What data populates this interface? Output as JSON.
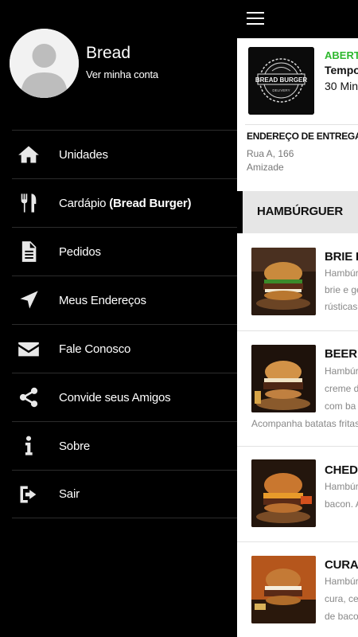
{
  "drawer": {
    "profile": {
      "name": "Bread",
      "link": "Ver minha conta"
    },
    "items": [
      {
        "icon": "home-icon",
        "label": "Unidades",
        "bold": ""
      },
      {
        "icon": "utensils-icon",
        "label": "Cardápio ",
        "bold": "(Bread Burger)"
      },
      {
        "icon": "document-icon",
        "label": "Pedidos",
        "bold": ""
      },
      {
        "icon": "navigation-arrow-icon",
        "label": "Meus Endereços",
        "bold": ""
      },
      {
        "icon": "envelope-icon",
        "label": "Fale Conosco",
        "bold": ""
      },
      {
        "icon": "share-icon",
        "label": "Convide seus Amigos",
        "bold": ""
      },
      {
        "icon": "info-icon",
        "label": "Sobre",
        "bold": ""
      },
      {
        "icon": "sign-out-icon",
        "label": "Sair",
        "bold": ""
      }
    ]
  },
  "store": {
    "logo_text": "BREAD BURGER",
    "logo_sub": "DELIVERY",
    "status": "ABERTO",
    "time_label": "Tempo",
    "time_value": "30 Min",
    "address_label": "ENDEREÇO DE ENTREGAS",
    "address_street": "Rua A, 166",
    "address_area": "Amizade"
  },
  "category": {
    "label": "HAMBÚRGUER"
  },
  "products": [
    {
      "name": "BRIE B",
      "desc": [
        "Hambúr",
        "brie e ge",
        "rústicas."
      ],
      "extra": ""
    },
    {
      "name": "BEER B",
      "desc": [
        "Hambúr",
        "creme de",
        "com ba"
      ],
      "extra": "Acompanha batatas fritas."
    },
    {
      "name": "CHED",
      "desc": [
        "Hambúr",
        "bacon. A"
      ],
      "extra": ""
    },
    {
      "name": "CURA",
      "desc": [
        "Hambúr",
        "cura, ceb",
        "de bacon"
      ],
      "extra": ""
    }
  ],
  "colors": {
    "status_open": "#2eb82e",
    "drawer_bg": "#000000",
    "category_bg": "#e6e6e6"
  }
}
